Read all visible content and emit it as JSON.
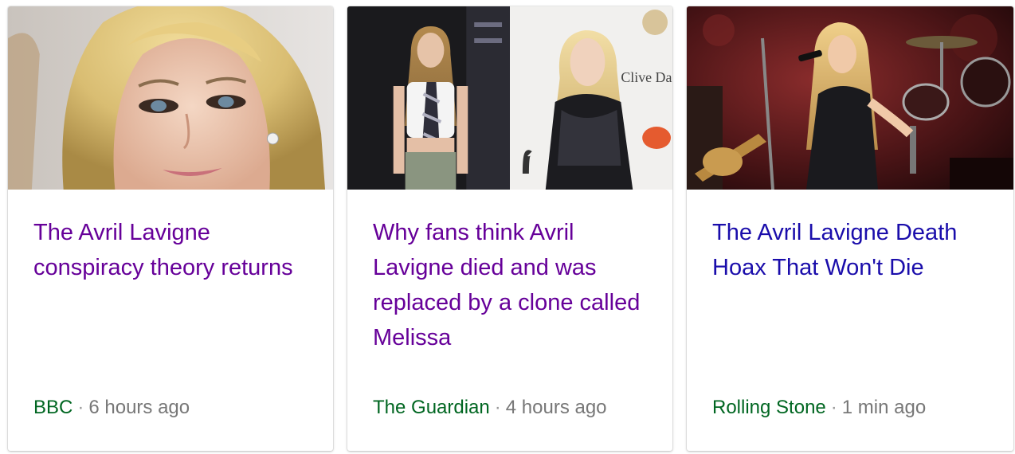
{
  "cards": [
    {
      "image_alt": "Avril Lavigne close-up portrait",
      "headline": "The Avril Lavigne conspiracy theory returns",
      "source": "BBC",
      "separator": "·",
      "time": "6 hours ago",
      "visited": true
    },
    {
      "image_alt": "Two photos of Avril Lavigne side by side",
      "headline": "Why fans think Avril Lavigne died and was replaced by a clone called Melissa",
      "source": "The Guardian",
      "separator": "·",
      "time": "4 hours ago",
      "visited": true
    },
    {
      "image_alt": "Avril Lavigne singing on stage",
      "headline": "The Avril Lavigne Death Hoax That Won't Die",
      "source": "Rolling Stone",
      "separator": "·",
      "time": "1 min ago",
      "visited": false
    }
  ],
  "colors": {
    "visited_link": "#660099",
    "unvisited_link": "#1a0dab",
    "source": "#006621",
    "meta": "#777777"
  },
  "image_text": {
    "backdrop_sign": "Clive Da"
  }
}
